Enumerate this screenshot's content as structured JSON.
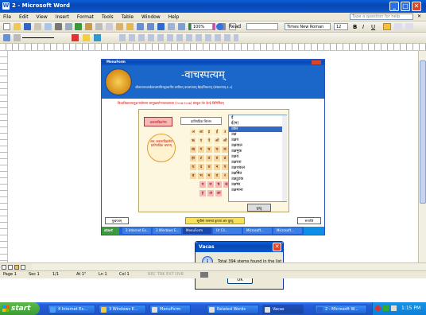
{
  "window": {
    "title": "2 - Microsoft Word"
  },
  "menu": {
    "items": [
      "File",
      "Edit",
      "View",
      "Insert",
      "Format",
      "Tools",
      "Table",
      "Window",
      "Help"
    ],
    "help_placeholder": "Type a question for help"
  },
  "toolbar": {
    "zoom": "100%",
    "read": "Read",
    "font": "Times New Roman",
    "size": "12",
    "bold": "B",
    "italic": "I",
    "underline": "U"
  },
  "app": {
    "title": "MenuForm",
    "logo_title": "-वाचस्पत्यम्",
    "subtitle": "श्रीतारानाथतर्कवाचस्पतिभट्टाचार्येण प्रणीतम् वाचस्पत्यम् बैह्दभिधानम् (संस्करणम्-१.०)",
    "sub2": "विश्वविद्यालयानुदानायोगस्य सम्मुखायोगनालवायसा (२००७-२००७) संस्कृत-नेट केन्द्रे विनिर्मितम्",
    "left_label": "अकारादिक्रमेण",
    "circle_label": "अथ अकारादिक्रमेण प्रातिपदिक चयनम्",
    "tab_label": "प्रातिपदिक चिन्तन",
    "list_items": [
      "ई",
      "ई(म)",
      "उक्त",
      "उक्ष",
      "उक्षप",
      "उक्षवाल",
      "उक्षमुक",
      "उक्षय",
      "उक्षरता",
      "उक्षशकल",
      "उक्षषित",
      "उक्षटुटक",
      "उक्षष्य",
      "उक्षमाना"
    ],
    "selected_index": 2,
    "select_button": "चुनहु",
    "bottom_left": "मुखपत्रम्",
    "bottom_center": "सूचीमां यत्नमवं कृपया अत्र चुनहु",
    "bottom_right": "समाप्ति"
  },
  "inner_taskbar": {
    "start": "start",
    "items": [
      "3 Internet Ex...",
      "3 Windows E...",
      "MenuForm",
      "Ur Cli...",
      "Microsoft...",
      "Microsoft..."
    ]
  },
  "dialog": {
    "title": "Vacas",
    "message": "Total 394 stems found in the list",
    "ok": "OK"
  },
  "status": {
    "page": "Page 1",
    "sec": "Sec 1",
    "pages": "1/1",
    "at": "At 1\"",
    "ln": "Ln 1",
    "col": "Col 1",
    "flags": "REC  TRK  EXT  OVR"
  },
  "taskbar": {
    "start": "start",
    "items": [
      "4 Internet Ex...",
      "3 Windows E...",
      "MenuForm",
      "Related Words",
      "Vacas",
      "2 - Microsoft W..."
    ],
    "clock": "1:15 PM"
  }
}
